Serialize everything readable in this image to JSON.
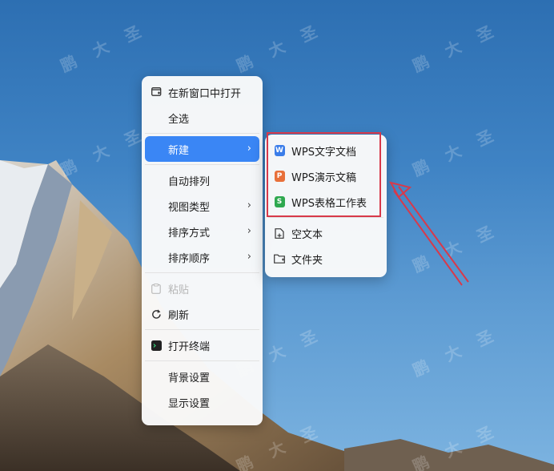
{
  "context_menu": {
    "items": [
      {
        "label": "在新窗口中打开",
        "icon": "new-window-icon"
      },
      {
        "label": "全选"
      },
      {
        "label": "新建",
        "has_submenu": true,
        "active": true
      },
      {
        "label": "自动排列"
      },
      {
        "label": "视图类型",
        "has_submenu": true
      },
      {
        "label": "排序方式",
        "has_submenu": true
      },
      {
        "label": "排序顺序",
        "has_submenu": true
      },
      {
        "label": "粘贴",
        "icon": "paste-icon",
        "disabled": true
      },
      {
        "label": "刷新",
        "icon": "refresh-icon"
      },
      {
        "label": "打开终端",
        "icon": "terminal-icon"
      },
      {
        "label": "背景设置"
      },
      {
        "label": "显示设置"
      }
    ]
  },
  "new_submenu": {
    "items": [
      {
        "label": "WPS文字文档",
        "icon": "wps-writer-icon",
        "color": "#3b7de9",
        "glyph": "W"
      },
      {
        "label": "WPS演示文稿",
        "icon": "wps-presentation-icon",
        "color": "#e8703a",
        "glyph": "P"
      },
      {
        "label": "WPS表格工作表",
        "icon": "wps-spreadsheet-icon",
        "color": "#2fa84f",
        "glyph": "S"
      },
      {
        "label": "空文本",
        "icon": "blank-text-icon"
      },
      {
        "label": "文件夹",
        "icon": "folder-icon"
      }
    ]
  },
  "watermark": {
    "text": "鹏大圣"
  },
  "colors": {
    "accent": "#3a86f5",
    "highlight": "#d8394a"
  }
}
